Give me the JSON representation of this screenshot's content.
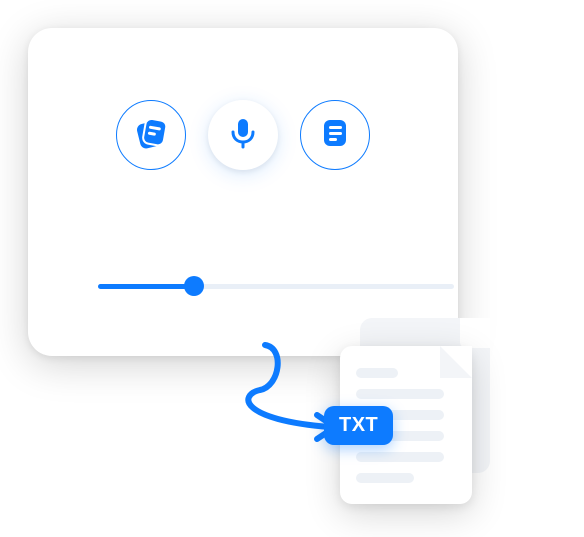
{
  "icons": {
    "notes": "notes-stack-icon",
    "mic": "microphone-icon",
    "doc": "document-icon"
  },
  "slider": {
    "progress_percent": 27
  },
  "export": {
    "badge_label": "TXT",
    "arrow": "curved-arrow-icon"
  },
  "colors": {
    "primary": "#0d7bff",
    "muted": "#e9eff7"
  }
}
